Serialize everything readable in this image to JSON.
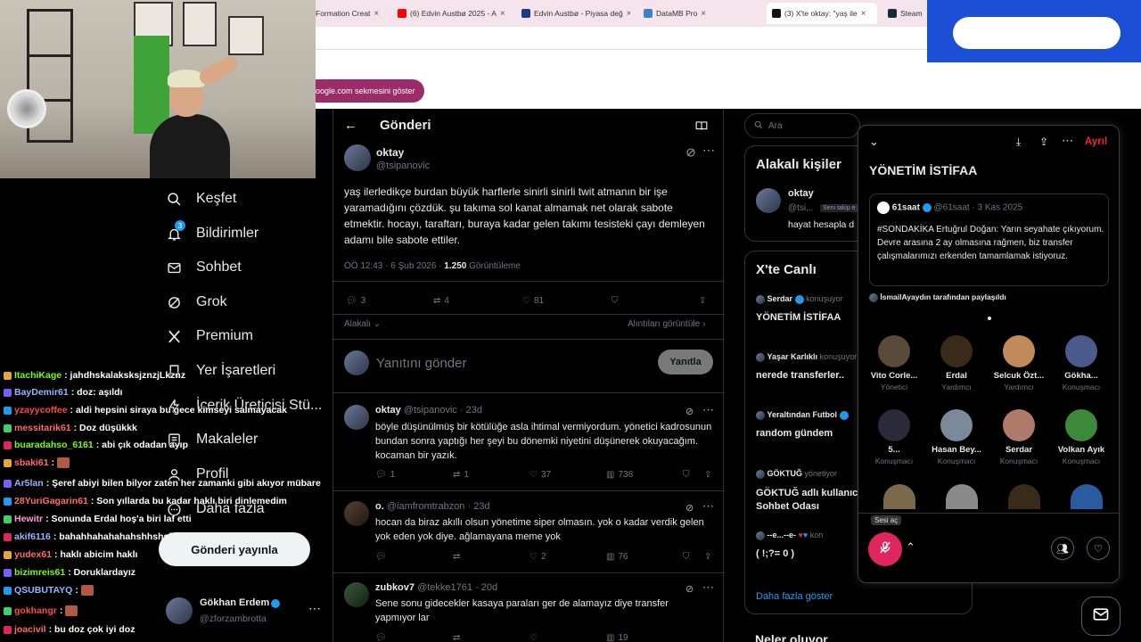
{
  "browser": {
    "tabs": [
      {
        "label": "Formation Creat",
        "color": "#ff7fb2"
      },
      {
        "label": "(6) Edvin Austbø 2025 - A",
        "color": "#ff0000"
      },
      {
        "label": "Edvin Austbø - Piyasa değ",
        "color": "#1a3a8a"
      },
      {
        "label": "DataMB Pro",
        "color": "#3b82c4"
      },
      {
        "label": "(3) X'te oktay: \"yaş ile",
        "color": "#111111"
      },
      {
        "label": "Steam",
        "color": "#1b2838"
      }
    ],
    "hint": "oogle.com sekmesini göster"
  },
  "nav": {
    "items": [
      {
        "label": "Keşfet",
        "icon": "search-icon"
      },
      {
        "label": "Bildirimler",
        "icon": "bell-icon",
        "badge": "3"
      },
      {
        "label": "Sohbet",
        "icon": "mail-icon"
      },
      {
        "label": "Grok",
        "icon": "grok-icon"
      },
      {
        "label": "Premium",
        "icon": "x-logo-icon"
      },
      {
        "label": "Yer İşaretleri",
        "icon": "bookmark-icon"
      },
      {
        "label": "İçerik Üreticisi Stü...",
        "icon": "lightning-icon"
      },
      {
        "label": "Makaleler",
        "icon": "article-icon"
      },
      {
        "label": "Profil",
        "icon": "user-icon"
      },
      {
        "label": "Daha fazla",
        "icon": "more-icon"
      }
    ],
    "post_button": "Gönderi yayınla",
    "profile": {
      "name": "Gökhan Erdem",
      "handle": "@zforzambrotta"
    }
  },
  "chat": [
    {
      "user": "ItachiKage",
      "color": "#7CFC00",
      "text": ": jahdhskalaksksjznzjLkznz"
    },
    {
      "user": "BayDemir61",
      "color": "#9ab4ff",
      "text": ": doz: aşıldı"
    },
    {
      "user": "yzayycoffee",
      "color": "#ff4a4a",
      "text": ": aldi hepsini siraya bu gece kimseyi salmayacak"
    },
    {
      "user": "messitarik61",
      "color": "#ff6b6b",
      "text": ": Doz düşükkk"
    },
    {
      "user": "buaradahso_6161",
      "color": "#7CFC00",
      "text": ": abi çık odadan ayıp"
    },
    {
      "user": "sbaki61",
      "color": "#ff6b6b",
      "text": ":"
    },
    {
      "user": "Ar5lan",
      "color": "#9ab4ff",
      "text": ": Şeref abiyi bilen bilyor zaten her zamanki gibi akıyor mübarek"
    },
    {
      "user": "28YuriGagarin61",
      "color": "#ff6b6b",
      "text": ": Son yıllarda bu kadar haklı biri dinlemedim"
    },
    {
      "user": "Hewitr",
      "color": "#ff9ad5",
      "text": ": Sonunda Erdal hoş'a biri laf etti"
    },
    {
      "user": "akif6116",
      "color": "#9ab4ff",
      "text": ": bahahhahahahahshhshshshshsuhshshah"
    },
    {
      "user": "yudex61",
      "color": "#ff6b6b",
      "text": ": haklı abicim haklı"
    },
    {
      "user": "bizimreis61",
      "color": "#7CFC00",
      "text": ": Doruklardayız"
    },
    {
      "user": "QSUBUTAYQ",
      "color": "#9ab4ff",
      "text": ":"
    },
    {
      "user": "gokhangr",
      "color": "#ff4a4a",
      "text": ":"
    },
    {
      "user": "joacivil",
      "color": "#ff6b6b",
      "text": ": bu doz çok iyi doz"
    }
  ],
  "main": {
    "header": "Gönderi",
    "post": {
      "name": "oktay",
      "handle": "@tsipanovic",
      "text": "yaş ilerledikçe burdan büyük harflerle sinirli sinirli twit atmanın bir işe yaramadığını çözdük. şu takıma sol kanat almamak net olarak sabote etmektir. hocayı, taraftarı, buraya kadar gelen takımı tesisteki çayı demleyen adamı bile sabote ettiler.",
      "time": "ÖÖ 12:43 · 6 Şub 2026 ·",
      "views": "1.250",
      "views_label": "Görüntüleme",
      "replies": "3",
      "reposts": "4",
      "likes": "81",
      "relevance": "Alakalı",
      "quotes_link": "Alıntıları görüntüle"
    },
    "reply_placeholder": "Yanıtını gönder",
    "reply_button": "Yanıtla",
    "replies": [
      {
        "name": "oktay",
        "handle": "@tsipanovic · 23d",
        "text": "böyle düşünülmüş bir kötülüğe asla ihtimal vermiyordum. yönetici kadrosunun bundan sonra yaptığı her şeyi bu dönemki niyetini düşünerek okuyacağım. kocaman bir yazık.",
        "replies": "1",
        "reposts": "1",
        "likes": "37",
        "views": "738"
      },
      {
        "name": "o.",
        "handle": "@iamfromtrabzon · 23d",
        "text": "hocan da biraz akıllı olsun yönetime siper olmasın. yok o kadar verdik gelen yok eden yok diye. ağlamayana meme yok",
        "replies": "",
        "reposts": "",
        "likes": "2",
        "views": "76"
      },
      {
        "name": "zubkov7",
        "handle": "@tekke1761 · 20d",
        "text": "Sene sonu gidecekler kasaya paraları ger de alamayız diye transfer yapmıyor lar",
        "replies": "",
        "reposts": "",
        "likes": "",
        "views": "19"
      }
    ]
  },
  "right": {
    "search_placeholder": "Ara",
    "related_title": "Alakalı kişiler",
    "related_name": "oktay",
    "related_handle": "@tsi...",
    "related_follow": "Seni takip e",
    "related_bio": "hayat hesapla d",
    "live_title": "X'te Canlı",
    "live": [
      {
        "host": "Serdar",
        "status": "konuşuyor",
        "title": "YÖNETİM İSTİFAA"
      },
      {
        "host": "Yaşar Karlıklı",
        "status": "konuşuyor",
        "title": "nerede transferler.."
      },
      {
        "host": "Yeraltından Futbol",
        "status": "",
        "title": "random gündem"
      },
      {
        "host": "GÖKTUĞ",
        "status": "yönetiyor",
        "title": "GÖKTUĞ adlı kullanıc Sohbet Odası"
      },
      {
        "host": "--e...--e-",
        "status": "kon",
        "title": "( !;?= 0 )"
      }
    ],
    "show_more": "Daha fazla göster",
    "bottom_partial": "Neler oluyor"
  },
  "space": {
    "leave": "Ayrıl",
    "title": "YÖNETİM İSTİFAA",
    "quote": {
      "name": "61saat",
      "handle": "@61saat · 3 Kas 2025",
      "text": "#SONDAKİKA Ertuğrul Doğan: Yarın seyahate çıkıyorum. Devre arasına 2 ay olmasına rağmen, biz transfer çalışmalarımızı erkenden tamamlamak istiyoruz."
    },
    "shared_by": "İsmailAyaydın tarafından paylaşıldı",
    "speakers": [
      {
        "name": "Vito Corle...",
        "role": "Yönetici",
        "color": "#5a4a3a"
      },
      {
        "name": "Erdal",
        "role": "Yardımcı",
        "color": "#3a2a1a"
      },
      {
        "name": "Selcuk Özt...",
        "role": "Yardımcı",
        "color": "#c08a5a"
      },
      {
        "name": "Gökha...",
        "role": "Konuşmacı",
        "color": "#4a5a8a"
      },
      {
        "name": "5...",
        "role": "Konuşmacı",
        "color": "#2a2a3a"
      },
      {
        "name": "Hasan Bey...",
        "role": "Konuşmacı",
        "color": "#7a8a9a"
      },
      {
        "name": "Serdar",
        "role": "Konuşmacı",
        "color": "#b07a6a"
      },
      {
        "name": "Volkan Ayık",
        "role": "Konuşmacı",
        "color": "#3a8a3a"
      }
    ],
    "mic_tooltip": "Sesi aç"
  }
}
